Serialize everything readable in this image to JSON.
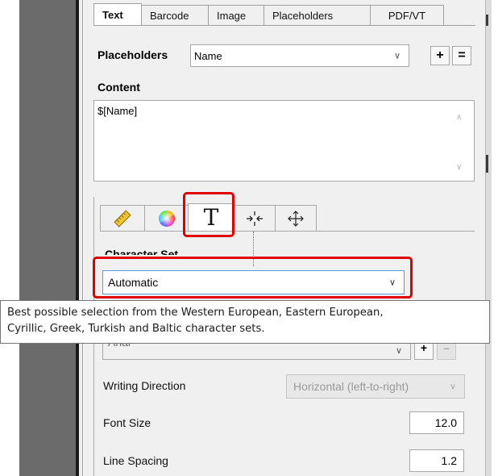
{
  "tabs": {
    "text": "Text",
    "barcode": "Barcode",
    "image": "Image",
    "placeholders": "Placeholders",
    "pdfvt": "PDF/VT"
  },
  "placeholders_row": {
    "label": "Placeholders",
    "value": "Name",
    "add": "+",
    "equals": "="
  },
  "content": {
    "label": "Content",
    "value": "$[Name]"
  },
  "inner_tabs": {
    "items": [
      "ruler-icon",
      "color-wheel-icon",
      "text-format-icon",
      "compress-icon",
      "move-icon"
    ],
    "text_glyph": "T"
  },
  "character_set": {
    "label": "Character Set",
    "value": "Automatic",
    "tooltip_line1": "Best possible selection from the Western European, Eastern European,",
    "tooltip_line2": "Cyrillic, Greek, Turkish and Baltic character sets."
  },
  "font": {
    "value": "Arial",
    "add": "+",
    "remove": "–"
  },
  "writing_direction": {
    "label": "Writing Direction",
    "value": "Horizontal (left-to-right)"
  },
  "font_size": {
    "label": "Font Size",
    "value": "12.0"
  },
  "line_spacing": {
    "label": "Line Spacing",
    "value": "1.2"
  },
  "colors": {
    "highlight": "#e00000",
    "focus_border": "#5a9ad8",
    "panel_bg": "#f0f0f0"
  }
}
